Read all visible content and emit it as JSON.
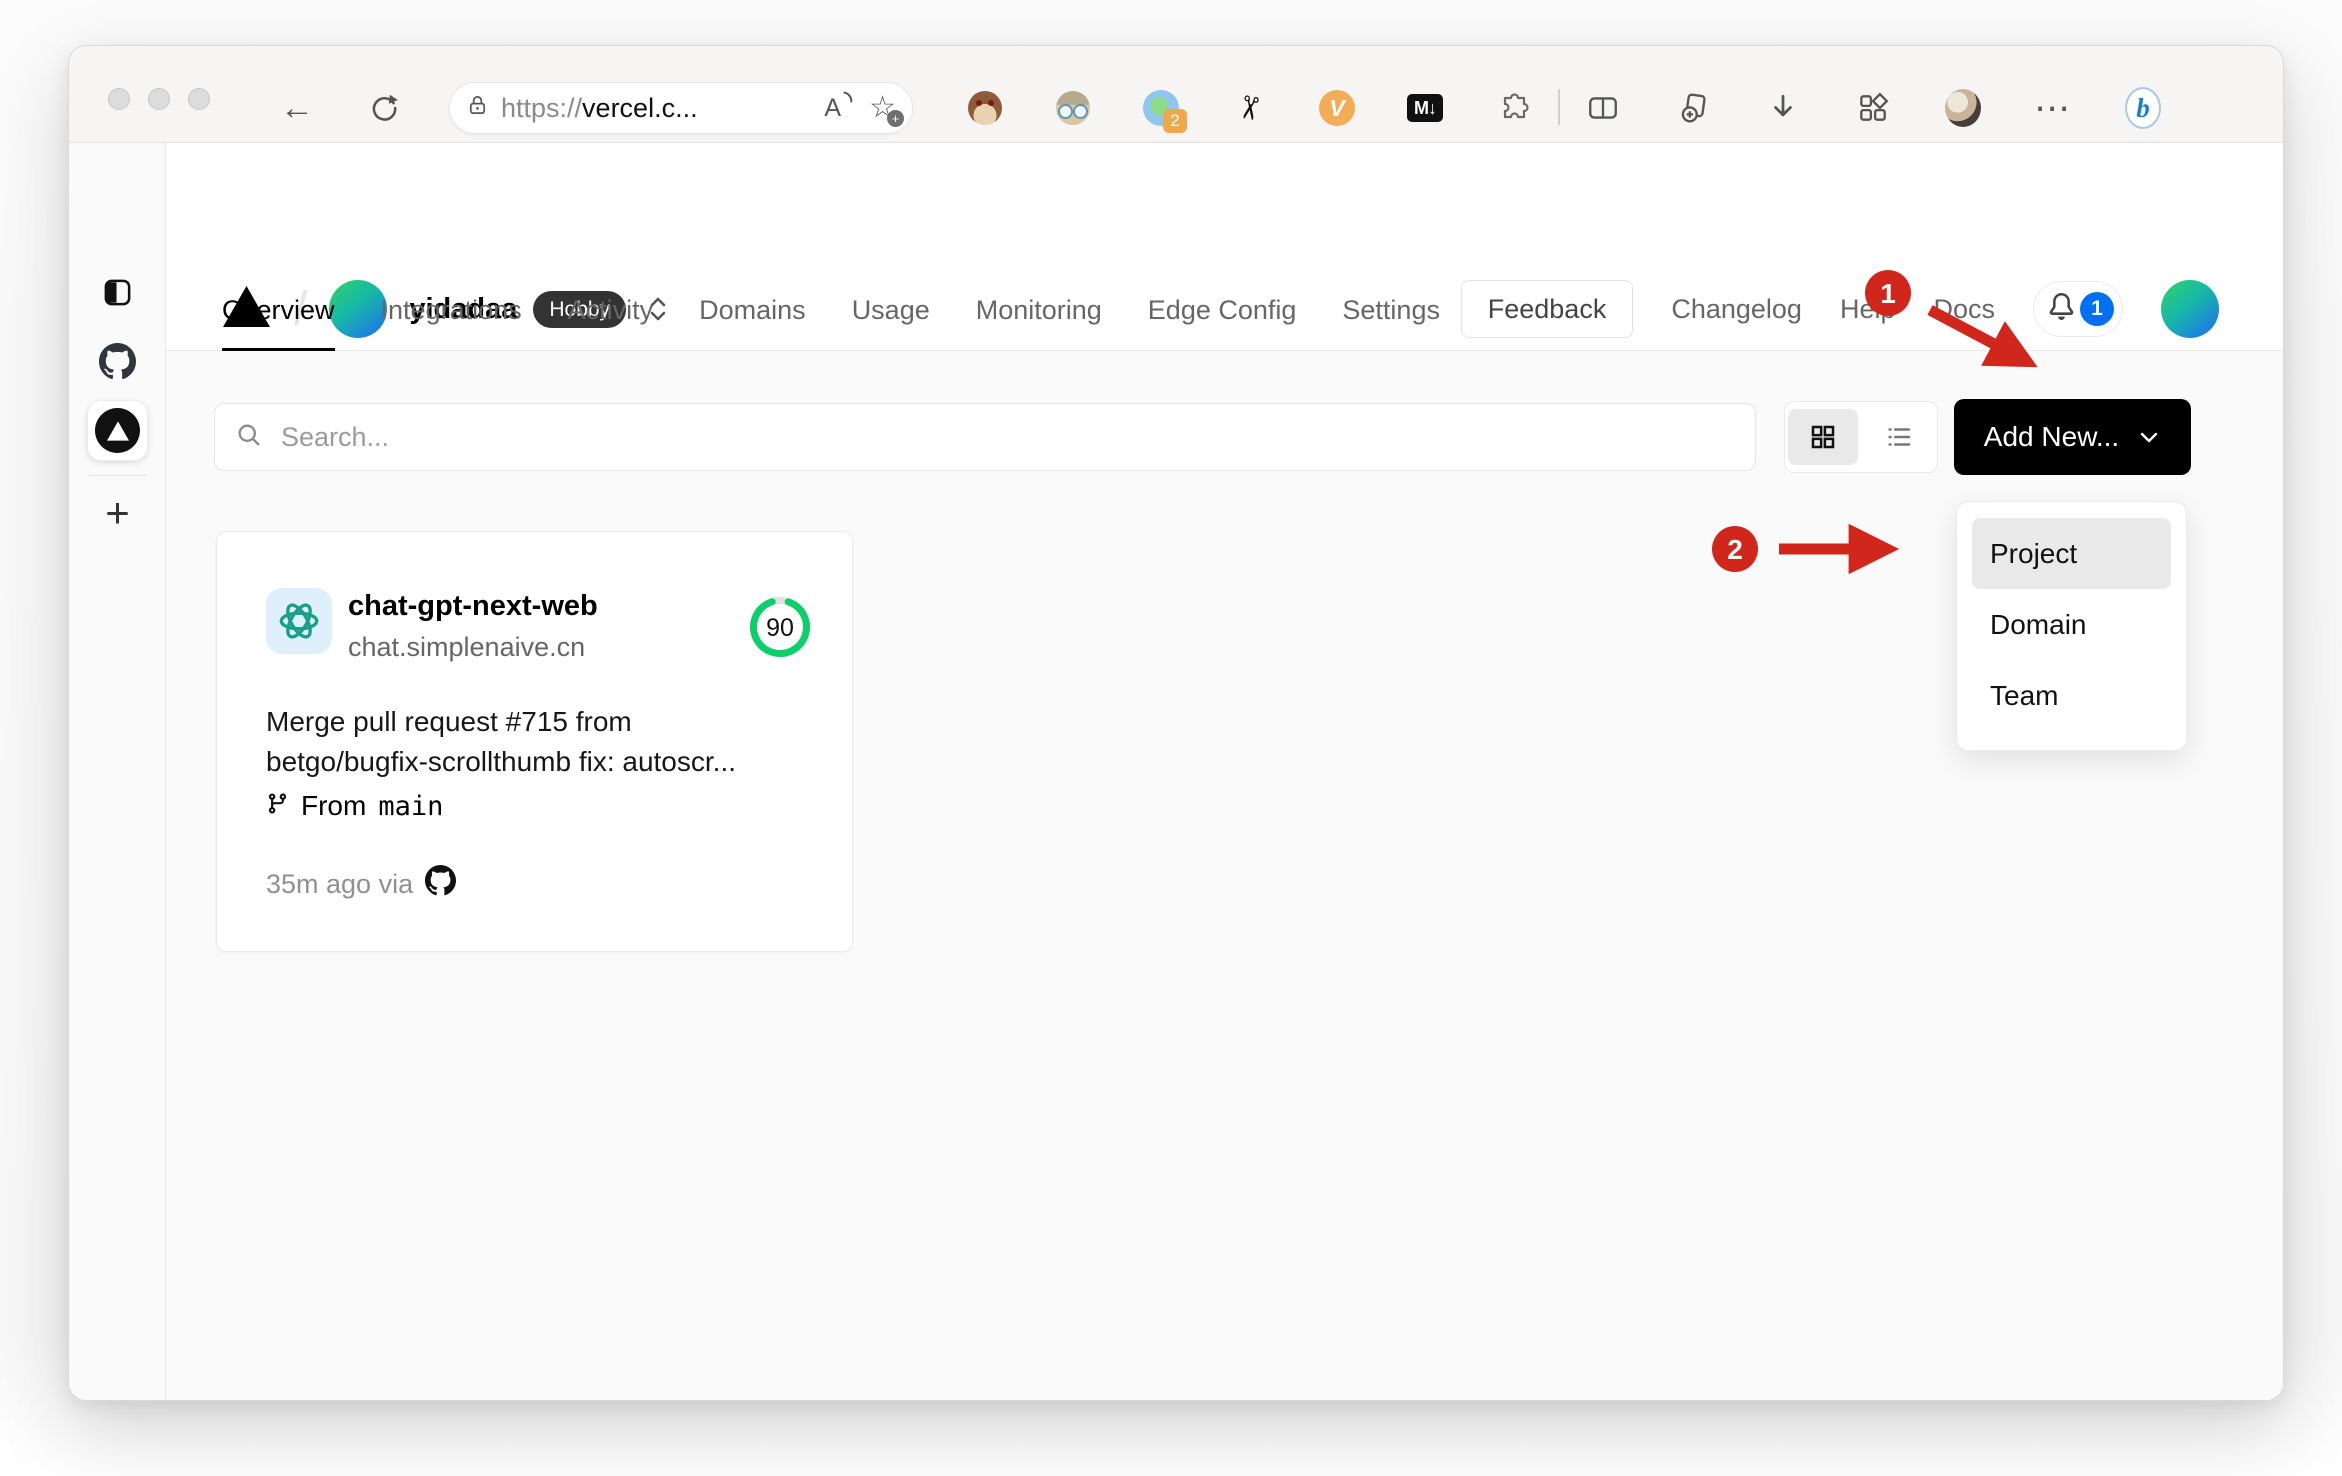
{
  "browser": {
    "back_glyph": "←",
    "url_scheme": "https://",
    "url_host": "vercel.c...",
    "read_aloud_label": "A",
    "star_glyph": "☆",
    "star_plus": "+",
    "scissors_glyph": "✂",
    "extension_badge_count": "2",
    "vdh_label": "V",
    "markdown_label": "M↓",
    "more_glyph": "⋯",
    "bing_label": "b",
    "sidebar_plus": "+"
  },
  "header": {
    "team_name": "yidadaa",
    "plan_badge": "Hobby",
    "breadcrumb_slash": "/",
    "feedback_label": "Feedback",
    "links": [
      {
        "label": "Changelog"
      },
      {
        "label": "Help"
      },
      {
        "label": "Docs"
      }
    ],
    "notification_count": "1"
  },
  "tabs": {
    "items": [
      {
        "label": "Overview"
      },
      {
        "label": "Integrations"
      },
      {
        "label": "Activity"
      },
      {
        "label": "Domains"
      },
      {
        "label": "Usage"
      },
      {
        "label": "Monitoring"
      },
      {
        "label": "Edge Config"
      },
      {
        "label": "Settings"
      }
    ],
    "active": "Overview"
  },
  "toolbar": {
    "search_placeholder": "Search...",
    "add_new_label": "Add New..."
  },
  "dropdown": {
    "items": [
      {
        "label": "Project"
      },
      {
        "label": "Domain"
      },
      {
        "label": "Team"
      }
    ],
    "highlighted": "Project"
  },
  "card": {
    "title": "chat-gpt-next-web",
    "domain": "chat.simplenaive.cn",
    "score": "90",
    "commit_line1": "Merge pull request #715 from",
    "commit_line2": "betgo/bugfix-scrollthumb fix: autoscr...",
    "from_label": "From",
    "branch": "main",
    "meta": "35m ago via"
  },
  "annotations": {
    "step1": "1",
    "step2": "2"
  },
  "colors": {
    "accent_blue": "#0070f3",
    "annotation_red": "#d0261b",
    "score_green": "#0cce6b",
    "openai_teal": "#16a08c",
    "add_new_bg": "#000000",
    "badge_bg": "#333333"
  }
}
